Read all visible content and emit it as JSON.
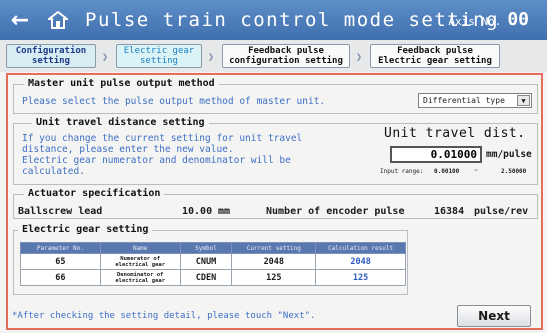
{
  "header": {
    "title": "Pulse train control mode setting",
    "axis_label": "Axis No.",
    "axis_number": "00",
    "back_icon": "back-arrow-icon",
    "home_icon": "home-icon"
  },
  "steps": [
    {
      "label_1": "Configuration",
      "label_2": "setting",
      "state": "done"
    },
    {
      "label_1": "Electric gear",
      "label_2": "setting",
      "state": "current"
    },
    {
      "label_1": "Feedback pulse",
      "label_2": "configuration setting",
      "state": "todo"
    },
    {
      "label_1": "Feedback pulse",
      "label_2": "Electric gear setting",
      "state": "todo"
    }
  ],
  "master": {
    "title": "Master unit pulse output method",
    "note": "Please select the pulse output method of master unit.",
    "selected": "Differential type"
  },
  "travel": {
    "title": "Unit travel distance setting",
    "note_1": "If you change the current setting for unit travel",
    "note_2": "distance, please enter the new value.",
    "note_3": "Electric gear numerator and denominator will be",
    "note_4": "calculated.",
    "label": "Unit travel dist.",
    "value": "0.01000",
    "unit": "mm/pulse",
    "range_label": "Input range:",
    "range_min": "0.00100",
    "range_sep": "~",
    "range_max": "2.50000"
  },
  "actuator": {
    "title": "Actuator specification",
    "ballscrew_label": "Ballscrew lead",
    "ballscrew_value": "10.00",
    "ballscrew_unit": "mm",
    "encoder_label": "Number of encoder pulse",
    "encoder_value": "16384",
    "encoder_unit": "pulse/rev"
  },
  "gear": {
    "title": "Electric gear setting",
    "columns": [
      "Parameter No.",
      "Name",
      "Symbol",
      "Current setting",
      "Calculation result"
    ],
    "rows": [
      {
        "no": "65",
        "name_1": "Numerator of",
        "name_2": "electrical gear",
        "symbol": "CNUM",
        "current": "2048",
        "calc": "2048"
      },
      {
        "no": "66",
        "name_1": "Denominator of",
        "name_2": "electrical gear",
        "symbol": "CDEN",
        "current": "125",
        "calc": "125"
      }
    ]
  },
  "footer": {
    "note": "*After checking the setting detail, please touch \"Next\".",
    "next_label": "Next"
  },
  "colors": {
    "header": "#4a7cbc",
    "frame_border": "#e46e5a",
    "note_text": "#3e6fc7",
    "table_header": "#5a78b0"
  }
}
